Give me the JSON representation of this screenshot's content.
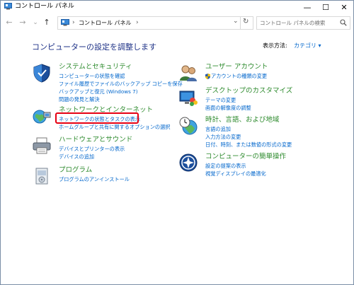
{
  "window": {
    "title": "コントロール パネル",
    "minimize": "—",
    "maximize": "☐",
    "close": "✕"
  },
  "toolbar": {
    "back": "←",
    "forward": "→",
    "recent": "⌄",
    "up": "↑",
    "crumb": "コントロール パネル",
    "sep1": "›",
    "sep2": "›",
    "dropdown": "⌄",
    "refresh": "↻",
    "search_placeholder": "コントロール パネルの検索"
  },
  "main": {
    "heading": "コンピューターの設定を調整します",
    "view_by_label": "表示方法:",
    "view_by_value": "カテゴリ ▾"
  },
  "categories_left": [
    {
      "title": "システムとセキュリティ",
      "links": [
        "コンピューターの状態を確認",
        "ファイル履歴でファイルのバックアップ コピーを保存",
        "バックアップと復元 (Windows 7)",
        "問題の発見と解決"
      ]
    },
    {
      "title": "ネットワークとインターネット",
      "links": [
        "ネットワークの状態とタスクの表示",
        "ホームグループと共有に関するオプションの選択"
      ]
    },
    {
      "title": "ハードウェアとサウンド",
      "links": [
        "デバイスとプリンターの表示",
        "デバイスの追加"
      ]
    },
    {
      "title": "プログラム",
      "links": [
        "プログラムのアンインストール"
      ]
    }
  ],
  "categories_right": [
    {
      "title": "ユーザー アカウント",
      "links": [
        "アカウントの種類の変更"
      ]
    },
    {
      "title": "デスクトップのカスタマイズ",
      "links": [
        "テーマの変更",
        "画面の解像度の調整"
      ]
    },
    {
      "title": "時計、言語、および地域",
      "links": [
        "言語の追加",
        "入力方法の変更",
        "日付、時刻、または数値の形式の変更"
      ]
    },
    {
      "title": "コンピューターの簡単操作",
      "links": [
        "設定の提案の表示",
        "視覚ディスプレイの最適化"
      ]
    }
  ],
  "colors": {
    "heading": "#1e3287",
    "category_title": "#2e8b2e",
    "link": "#0066cc",
    "highlight": "#e60012"
  }
}
